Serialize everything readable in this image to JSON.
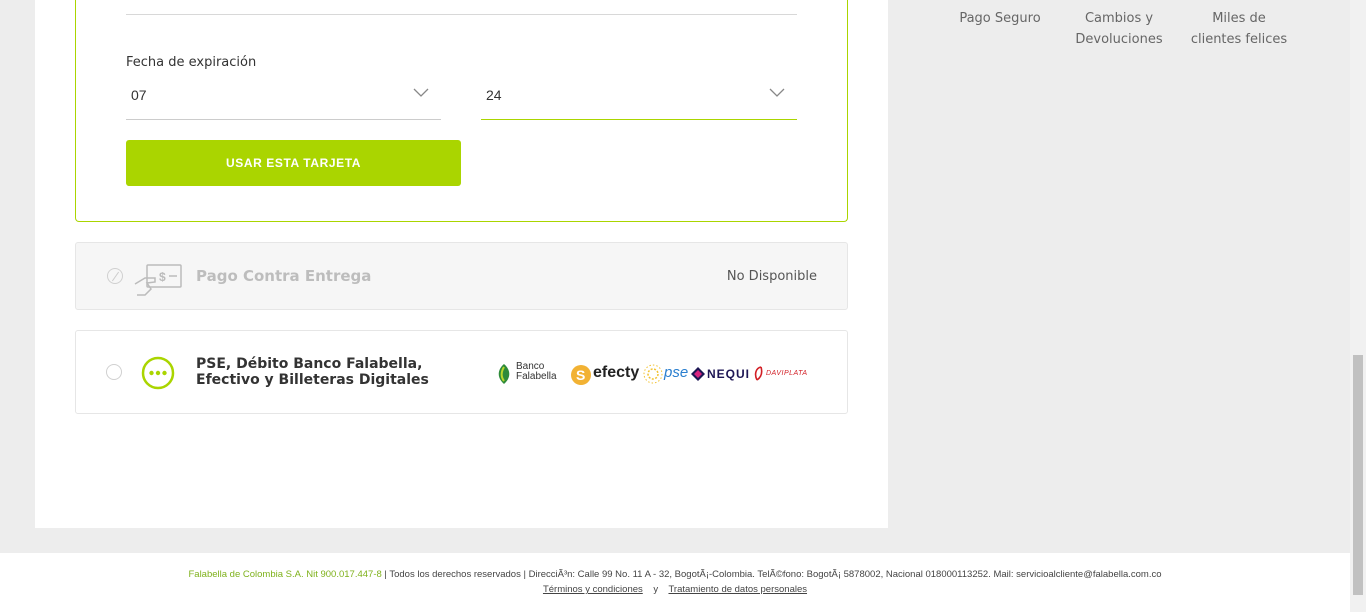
{
  "card_form": {
    "expiration_label": "Fecha de expiración",
    "month_value": "07",
    "year_value": "24",
    "submit_label": "USAR ESTA TARJETA"
  },
  "payment_options": {
    "cash_on_delivery": {
      "title": "Pago Contra Entrega",
      "status": "No Disponible"
    },
    "pse": {
      "title": "PSE, Débito Banco Falabella, Efectivo y Billeteras Digitales",
      "logos": {
        "banco_falabella_line1": "Banco",
        "banco_falabella_line2": "Falabella",
        "efecty": "efecty",
        "pse": "pse",
        "nequi": "NEQUI",
        "daviplata": "DAVIPLATA"
      }
    }
  },
  "trust_badges": [
    {
      "line1": "Pago Seguro",
      "line2": ""
    },
    {
      "line1": "Cambios y",
      "line2": "Devoluciones"
    },
    {
      "line1": "Miles de",
      "line2": "clientes felices"
    }
  ],
  "footer": {
    "company": "Falabella de Colombia S.A. Nit 900.017.447-8",
    "info": "|  Todos los derechos reservados  |  DirecciÃ³n: Calle 99 No. 11 A - 32, BogotÃ¡-Colombia. TelÃ©fono: BogotÃ¡ 5878002, Nacional 018000113252. Mail: servicioalcliente@falabella.com.co",
    "terms_link": "Términos y condiciones",
    "separator": "y",
    "privacy_link": "Tratamiento de datos personales"
  },
  "colors": {
    "accent": "#aad500",
    "brand_green": "#7fb21c"
  }
}
